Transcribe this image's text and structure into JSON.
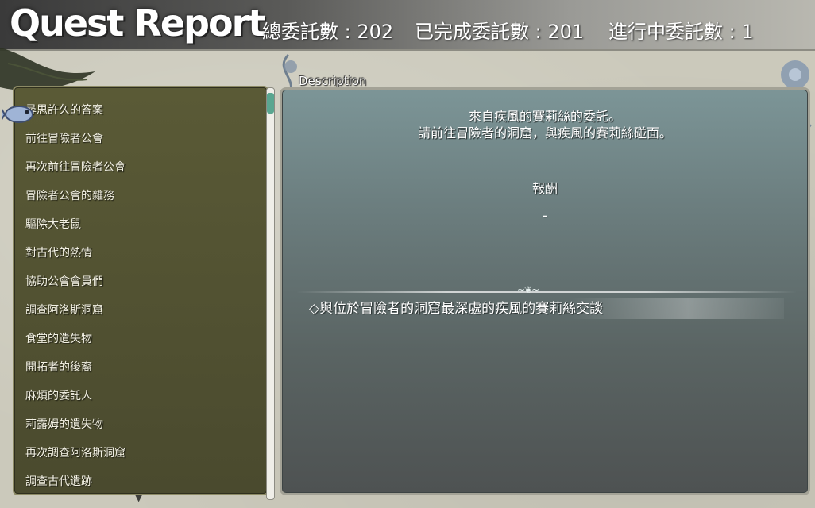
{
  "header": {
    "title": "Quest Report",
    "total_label": "總委託數 : 202",
    "completed_label": "已完成委託數 : 201",
    "in_progress_label": "進行中委託數 : 1"
  },
  "quest_list": {
    "items": [
      "尋思許久的答案",
      "前往冒險者公會",
      "再次前往冒險者公會",
      "冒險者公會的雜務",
      "驅除大老鼠",
      "對古代的熱情",
      "協助公會會員們",
      "調查阿洛斯洞窟",
      "食堂的遺失物",
      "開拓者的後裔",
      "麻煩的委託人",
      "莉露姆的遺失物",
      "再次調查阿洛斯洞窟",
      "調查古代遺跡"
    ],
    "selected_index": 0
  },
  "description": {
    "label": "Description",
    "line1": "來自疾風的賽莉絲的委託。",
    "line2": "請前往冒險者的洞窟，與疾風的賽莉絲碰面。",
    "reward_title": "報酬",
    "reward_value": "-",
    "objective": "◇與位於冒險者的洞窟最深處的疾風的賽莉絲交談"
  }
}
